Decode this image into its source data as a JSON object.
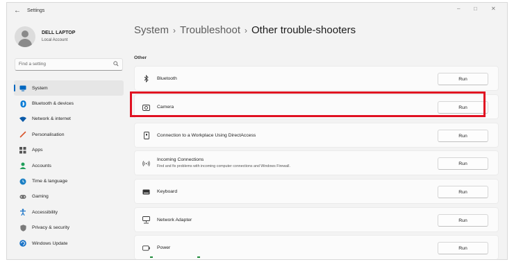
{
  "window": {
    "title": "Settings",
    "controls": {
      "minimize": "–",
      "maximize": "□",
      "close": "✕"
    }
  },
  "profile": {
    "name": "DELL LAPTOP",
    "subtitle": "Local Account",
    "icon": "user-avatar-icon"
  },
  "search": {
    "placeholder": "Find a setting",
    "icon": "search-icon"
  },
  "sidebar": {
    "items": [
      {
        "label": "System",
        "icon": "system-monitor-icon",
        "color": "#0067c0",
        "active": true
      },
      {
        "label": "Bluetooth & devices",
        "icon": "bluetooth-icon",
        "color": "#0078d4"
      },
      {
        "label": "Network & internet",
        "icon": "network-wifi-icon",
        "color": "#0a5aa8"
      },
      {
        "label": "Personalisation",
        "icon": "paintbrush-icon",
        "color": "#d9552b"
      },
      {
        "label": "Apps",
        "icon": "apps-grid-icon",
        "color": "#555555"
      },
      {
        "label": "Accounts",
        "icon": "accounts-person-icon",
        "color": "#1f9e5a"
      },
      {
        "label": "Time & language",
        "icon": "globe-clock-icon",
        "color": "#1a7fc4"
      },
      {
        "label": "Gaming",
        "icon": "gamepad-icon",
        "color": "#6b6b6b"
      },
      {
        "label": "Accessibility",
        "icon": "accessibility-person-icon",
        "color": "#1a73c7"
      },
      {
        "label": "Privacy & security",
        "icon": "shield-icon",
        "color": "#7a7a7a"
      },
      {
        "label": "Windows Update",
        "icon": "windows-update-icon",
        "color": "#1a73c7"
      }
    ]
  },
  "breadcrumb": {
    "level1": "System",
    "level2": "Troubleshoot",
    "current": "Other trouble-shooters",
    "separator": "›"
  },
  "section": {
    "label": "Other"
  },
  "troubleshooters": [
    {
      "title": "Bluetooth",
      "icon": "bluetooth-icon",
      "button": "Run"
    },
    {
      "title": "Camera",
      "icon": "camera-icon",
      "button": "Run",
      "highlighted": true
    },
    {
      "title": "Connection to a Workplace Using DirectAccess",
      "icon": "workplace-device-icon",
      "button": "Run"
    },
    {
      "title": "Incoming Connections",
      "description": "Find and fix problems with incoming computer connections and Windows Firewall.",
      "icon": "incoming-connections-icon",
      "button": "Run"
    },
    {
      "title": "Keyboard",
      "icon": "keyboard-icon",
      "button": "Run"
    },
    {
      "title": "Network Adapter",
      "icon": "network-adapter-icon",
      "button": "Run"
    },
    {
      "title": "Power",
      "icon": "power-battery-icon",
      "button": "Run"
    }
  ],
  "colors": {
    "accent": "#0067c0",
    "highlight_box": "#e01021",
    "background": "#f3f3f3",
    "card": "#fbfbfb"
  }
}
